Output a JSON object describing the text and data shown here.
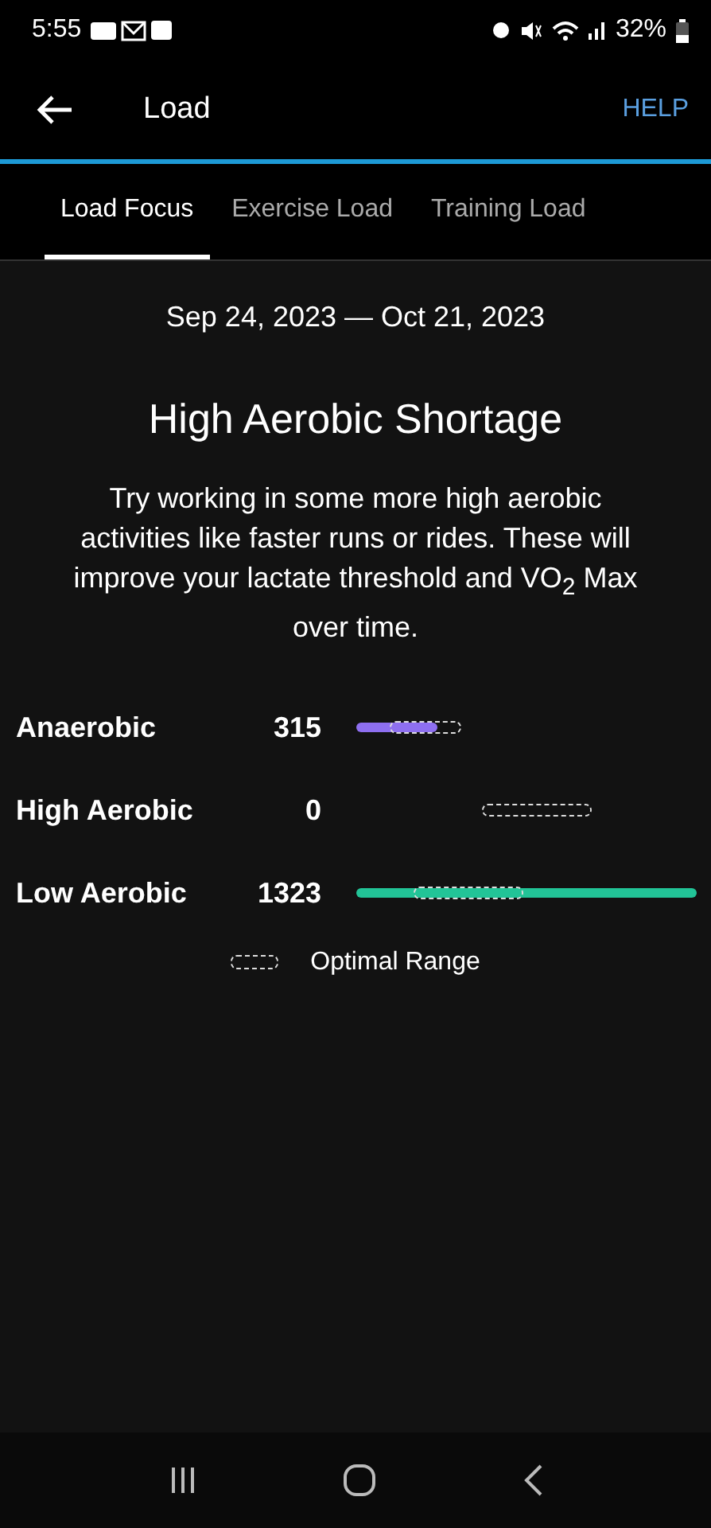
{
  "status_bar": {
    "time": "5:55",
    "battery": "32%"
  },
  "header": {
    "title": "Load",
    "help": "HELP"
  },
  "tabs": [
    {
      "label": "Load Focus",
      "selected": true
    },
    {
      "label": "Exercise Load",
      "selected": false
    },
    {
      "label": "Training Load",
      "selected": false
    }
  ],
  "date_range": "Sep 24, 2023 — Oct 21, 2023",
  "headline": "High Aerobic Shortage",
  "description": "Try working in some more high aerobic activities like faster runs or rides. These will improve your lactate threshold and VO$_{2}$ Max over time.",
  "rows": [
    {
      "label": "Anaerobic",
      "value": "315",
      "color": "#8e6ff0"
    },
    {
      "label": "High Aerobic",
      "value": "0"
    },
    {
      "label": "Low Aerobic",
      "value": "1323",
      "color": "#22c497"
    }
  ],
  "legend": "Optimal Range"
}
